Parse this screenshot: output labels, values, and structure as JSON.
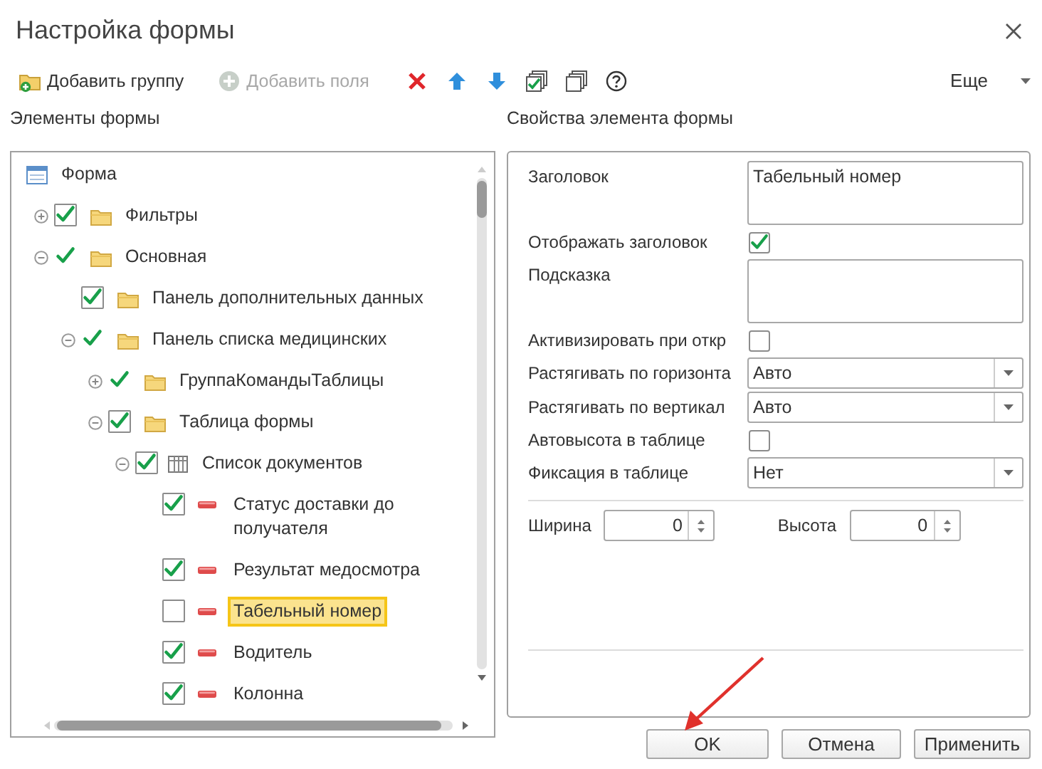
{
  "window": {
    "title": "Настройка формы"
  },
  "toolbar": {
    "items": [
      {
        "kind": "add-group",
        "label": "Добавить группу",
        "disabled": false
      },
      {
        "kind": "add-fields",
        "label": "Добавить поля",
        "disabled": true
      },
      {
        "kind": "delete",
        "disabled": false
      },
      {
        "kind": "up",
        "disabled": false
      },
      {
        "kind": "down",
        "disabled": false
      },
      {
        "kind": "check-all",
        "disabled": false
      },
      {
        "kind": "uncheck-all",
        "disabled": false
      },
      {
        "kind": "help",
        "disabled": false
      }
    ],
    "more": "Еще"
  },
  "tree": {
    "title": "Элементы формы",
    "items": [
      {
        "label": "Форма",
        "kind": "form",
        "selected": false,
        "children": [
          {
            "label": "Фильтры",
            "kind": "folder",
            "check": {
              "kind": "box",
              "checked": true
            },
            "expanded": false,
            "selected": false
          },
          {
            "label": "Основная",
            "kind": "folder",
            "check": {
              "kind": "bare",
              "checked": true
            },
            "expanded": true,
            "selected": false,
            "children": [
              {
                "label": "Панель дополнительных данных",
                "kind": "folder",
                "check": {
                  "kind": "box",
                  "checked": true
                },
                "selected": false
              },
              {
                "label": "Панель списка медицинских",
                "kind": "folder",
                "check": {
                  "kind": "bare",
                  "checked": true
                },
                "expanded": true,
                "selected": false,
                "children": [
                  {
                    "label": "ГруппаКомандыТаблицы",
                    "kind": "folder",
                    "check": {
                      "kind": "bare",
                      "checked": true
                    },
                    "expanded": false,
                    "selected": false
                  },
                  {
                    "label": "Таблица формы",
                    "kind": "folder",
                    "check": {
                      "kind": "box",
                      "checked": true
                    },
                    "expanded": true,
                    "selected": false,
                    "children": [
                      {
                        "label": "Список документов",
                        "kind": "table",
                        "check": {
                          "kind": "box",
                          "checked": true
                        },
                        "expanded": true,
                        "selected": false,
                        "children": [
                          {
                            "label": "Статус доставки до получателя",
                            "kind": "field",
                            "check": {
                              "kind": "box",
                              "checked": true
                            },
                            "selected": false
                          },
                          {
                            "label": "Результат медосмотра",
                            "kind": "field",
                            "check": {
                              "kind": "box",
                              "checked": true
                            },
                            "selected": false
                          },
                          {
                            "label": "Табельный номер",
                            "kind": "field",
                            "check": {
                              "kind": "box",
                              "checked": false
                            },
                            "selected": true
                          },
                          {
                            "label": "Водитель",
                            "kind": "field",
                            "check": {
                              "kind": "box",
                              "checked": true
                            },
                            "selected": false
                          },
                          {
                            "label": "Колонна",
                            "kind": "field",
                            "check": {
                              "kind": "box",
                              "checked": true
                            },
                            "selected": false
                          }
                        ]
                      }
                    ]
                  }
                ]
              }
            ]
          }
        ]
      }
    ]
  },
  "properties": {
    "title": "Свойства элемента формы",
    "rows": [
      {
        "kind": "textarea",
        "label": "Заголовок",
        "value": "Табельный номер"
      },
      {
        "kind": "checkbox",
        "label": "Отображать заголовок",
        "checked": true
      },
      {
        "kind": "textarea",
        "label": "Подсказка"
      },
      {
        "kind": "checkbox",
        "label": "Активизировать при откр",
        "checked": false
      },
      {
        "kind": "select",
        "label": "Растягивать по горизонта",
        "value": "Авто"
      },
      {
        "kind": "select",
        "label": "Растягивать по вертикал",
        "value": "Авто"
      },
      {
        "kind": "checkbox",
        "label": "Автовысота в таблице",
        "checked": false
      },
      {
        "kind": "select",
        "label": "Фиксация в таблице",
        "value": "Нет"
      }
    ],
    "size": [
      {
        "label": "Ширина",
        "value": "0"
      },
      {
        "label": "Высота",
        "value": "0"
      }
    ]
  },
  "buttons": [
    "OK",
    "Отмена",
    "Применить"
  ]
}
